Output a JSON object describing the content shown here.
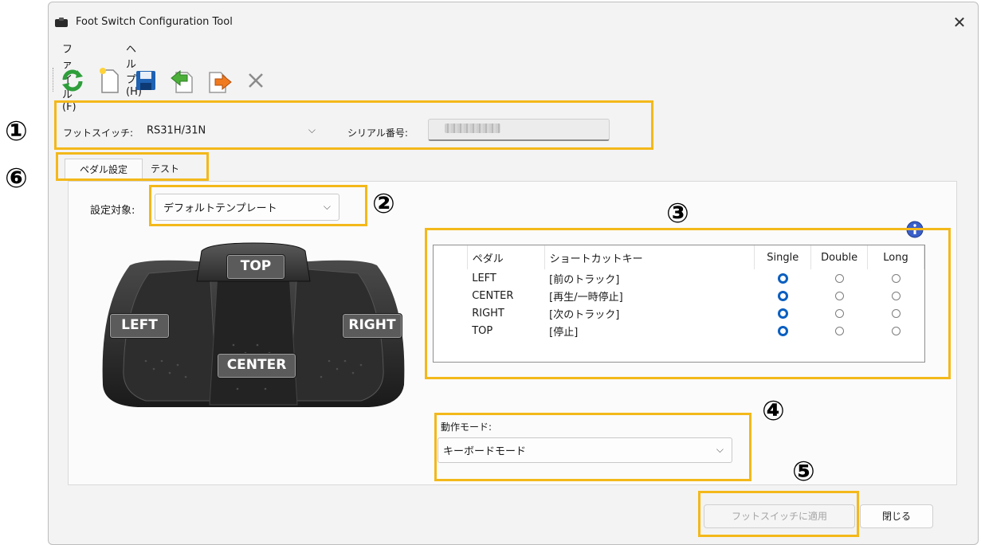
{
  "window": {
    "title": "Foot Switch Configuration Tool"
  },
  "menu": {
    "file": "ファイル(F)",
    "help": "ヘルプ(H)"
  },
  "toolbar": {
    "buttons": [
      "refresh-icon",
      "new-file-icon",
      "save-icon",
      "import-icon",
      "export-icon",
      "delete-icon"
    ]
  },
  "device": {
    "foot_switch_label": "フットスイッチ:",
    "foot_switch_value": "RS31H/31N",
    "serial_label": "シリアル番号:"
  },
  "tabs": {
    "pedal_settings": "ペダル設定",
    "test": "テスト"
  },
  "target": {
    "label": "設定対象:",
    "value": "デフォルトテンプレート"
  },
  "pedal_image": {
    "top": "TOP",
    "left": "LEFT",
    "right": "RIGHT",
    "center": "CENTER"
  },
  "grid": {
    "headers": {
      "pedal": "ペダル",
      "shortcut": "ショートカットキー",
      "single": "Single",
      "double": "Double",
      "long": "Long"
    },
    "rows": [
      {
        "pedal": "LEFT",
        "shortcut": "[前のトラック]",
        "mode": "single"
      },
      {
        "pedal": "CENTER",
        "shortcut": "[再生/一時停止]",
        "mode": "single"
      },
      {
        "pedal": "RIGHT",
        "shortcut": "[次のトラック]",
        "mode": "single"
      },
      {
        "pedal": "TOP",
        "shortcut": "[停止]",
        "mode": "single"
      }
    ]
  },
  "mode": {
    "label": "動作モード:",
    "value": "キーボードモード"
  },
  "buttons": {
    "apply": "フットスイッチに適用",
    "close": "閉じる"
  },
  "callouts": {
    "n1": "①",
    "n2": "②",
    "n3": "③",
    "n4": "④",
    "n5": "⑤",
    "n6": "⑥"
  },
  "colors": {
    "highlight": "#f3b81a",
    "radio_selected": "#0a5fc0"
  }
}
